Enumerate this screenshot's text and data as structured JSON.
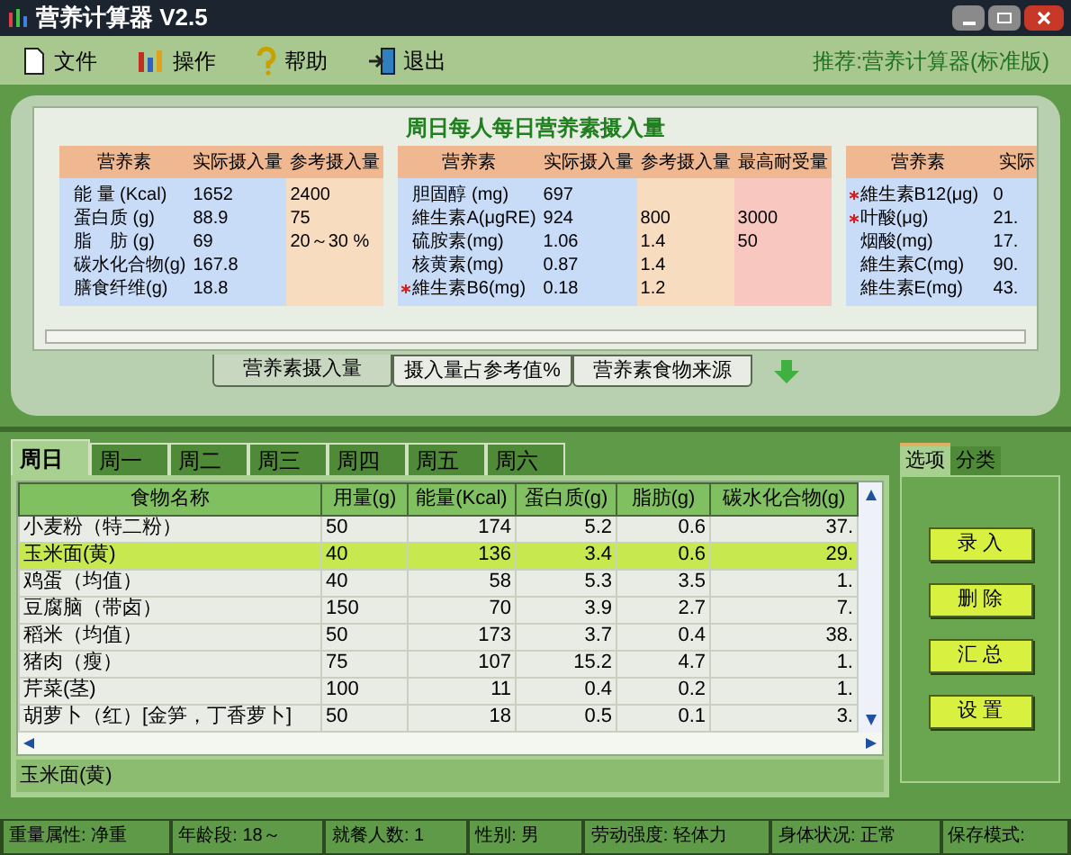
{
  "window": {
    "title": "营养计算器 V2.5"
  },
  "menu": [
    {
      "label": "文件"
    },
    {
      "label": "操作"
    },
    {
      "label": "帮助"
    },
    {
      "label": "退出"
    }
  ],
  "recommend": "推荐:营养计算器(标准版)",
  "summary": {
    "title": "周日每人每日营养素摄入量",
    "groups": [
      {
        "columns": [
          "营养素",
          "实际摄入量",
          "参考摄入量"
        ],
        "rows": [
          {
            "cells": [
              "能 量 (Kcal)",
              "1652",
              "2400"
            ],
            "flagged": false
          },
          {
            "cells": [
              "蛋白质 (g)",
              "88.9",
              "75"
            ],
            "flagged": false
          },
          {
            "cells": [
              "脂　肪 (g)",
              "69",
              "20～30 %"
            ],
            "flagged": false
          },
          {
            "cells": [
              "碳水化合物(g)",
              "167.8",
              ""
            ],
            "flagged": false
          },
          {
            "cells": [
              "膳食纤维(g)",
              "18.8",
              ""
            ],
            "flagged": false
          }
        ]
      },
      {
        "columns": [
          "营养素",
          "实际摄入量",
          "参考摄入量",
          "最高耐受量"
        ],
        "rows": [
          {
            "cells": [
              "胆固醇 (mg)",
              "697",
              "",
              ""
            ],
            "flagged": false
          },
          {
            "cells": [
              "維生素A(μgRE)",
              "924",
              "800",
              "3000"
            ],
            "flagged": false
          },
          {
            "cells": [
              "硫胺素(mg)",
              "1.06",
              "1.4",
              "50"
            ],
            "flagged": false
          },
          {
            "cells": [
              "核黄素(mg)",
              "0.87",
              "1.4",
              ""
            ],
            "flagged": false
          },
          {
            "cells": [
              "維生素B6(mg)",
              "0.18",
              "1.2",
              ""
            ],
            "flagged": true
          }
        ]
      },
      {
        "columns": [
          "营养素",
          "实际"
        ],
        "rows": [
          {
            "cells": [
              "維生素B12(μg)",
              "0"
            ],
            "flagged": true
          },
          {
            "cells": [
              "叶酸(μg)",
              "21."
            ],
            "flagged": true
          },
          {
            "cells": [
              "烟酸(mg)",
              "17."
            ],
            "flagged": false
          },
          {
            "cells": [
              "維生素C(mg)",
              "90."
            ],
            "flagged": false
          },
          {
            "cells": [
              "維生素E(mg)",
              "43."
            ],
            "flagged": false
          }
        ]
      }
    ]
  },
  "view_tabs": [
    {
      "label": "营养素摄入量",
      "selected": true
    },
    {
      "label": "摄入量占参考值%",
      "selected": false
    },
    {
      "label": "营养素食物来源",
      "selected": false
    }
  ],
  "day_tabs": [
    {
      "label": "周日",
      "selected": true
    },
    {
      "label": "周一",
      "selected": false
    },
    {
      "label": "周二",
      "selected": false
    },
    {
      "label": "周三",
      "selected": false
    },
    {
      "label": "周四",
      "selected": false
    },
    {
      "label": "周五",
      "selected": false
    },
    {
      "label": "周六",
      "selected": false
    }
  ],
  "table": {
    "columns": [
      "食物名称",
      "用量(g)",
      "能量(Kcal)",
      "蛋白质(g)",
      "脂肪(g)",
      "碳水化合物(g)"
    ],
    "rows": [
      {
        "cells": [
          "小麦粉（特二粉）",
          "50",
          "174",
          "5.2",
          "0.6",
          "37."
        ],
        "selected": false
      },
      {
        "cells": [
          "玉米面(黄)",
          "40",
          "136",
          "3.4",
          "0.6",
          "29."
        ],
        "selected": true
      },
      {
        "cells": [
          "鸡蛋（均值）",
          "40",
          "58",
          "5.3",
          "3.5",
          "1."
        ],
        "selected": false
      },
      {
        "cells": [
          "豆腐脑（带卤）",
          "150",
          "70",
          "3.9",
          "2.7",
          "7."
        ],
        "selected": false
      },
      {
        "cells": [
          "稻米（均值）",
          "50",
          "173",
          "3.7",
          "0.4",
          "38."
        ],
        "selected": false
      },
      {
        "cells": [
          "猪肉（瘦）",
          "75",
          "107",
          "15.2",
          "4.7",
          "1."
        ],
        "selected": false
      },
      {
        "cells": [
          "芹菜(茎)",
          "100",
          "11",
          "0.4",
          "0.2",
          "1."
        ],
        "selected": false
      },
      {
        "cells": [
          "胡萝卜（红）[金笋，丁香萝卜]",
          "50",
          "18",
          "0.5",
          "0.1",
          "3."
        ],
        "selected": false
      }
    ]
  },
  "current_food": "玉米面(黄)",
  "side_tabs": [
    {
      "label": "选项",
      "selected": true
    },
    {
      "label": "分类",
      "selected": false
    }
  ],
  "actions": [
    "录 入",
    "删 除",
    "汇 总",
    "设 置"
  ],
  "status_bar": [
    "重量属性: 净重",
    "年龄段: 18～",
    "就餐人数: 1",
    "性别: 男",
    "劳动强度: 轻体力",
    "身体状况: 正常",
    "保存模式:"
  ]
}
